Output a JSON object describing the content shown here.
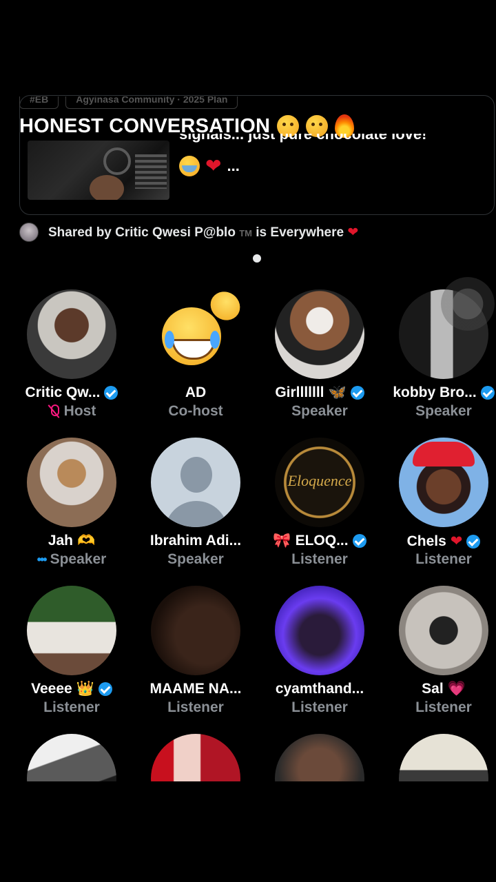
{
  "space": {
    "title": "HONEST CONVERSATION",
    "title_emojis": [
      "shushing-face-emoji",
      "steam-face-emoji",
      "fire-emoji"
    ],
    "tags": [
      "#EB",
      "Agyinasa Community · 2025 Plan"
    ],
    "preview_text_top": "signals... just pure chocolate love!",
    "preview_text_bottom": "..."
  },
  "shared_by": {
    "prefix": "Shared by Critic Qwesi P@blo",
    "tm": "TM",
    "suffix": "is Everywhere"
  },
  "colors": {
    "background": "#000000",
    "verified": "#1d9bf0",
    "host_mic": "#f91880",
    "role_text": "#8b9096"
  },
  "participants": [
    {
      "name": "Critic Qw...",
      "role": "Host",
      "verified": true,
      "icon": "mic-off-icon"
    },
    {
      "name": "AD",
      "role": "Co-host",
      "verified": false
    },
    {
      "name": "Girlllllll",
      "role": "Speaker",
      "verified": true,
      "name_emoji": "butterfly-emoji"
    },
    {
      "name": "kobby Bro...",
      "role": "Speaker",
      "verified": true
    },
    {
      "name": "Jah",
      "role": "Speaker",
      "verified": false,
      "name_emoji": "heart-hands-emoji",
      "icon": "talking-dots-icon"
    },
    {
      "name": "Ibrahim Adi...",
      "role": "Speaker",
      "verified": false
    },
    {
      "name": "ELOQ...",
      "role": "Listener",
      "verified": true,
      "name_emoji": "ribbon-emoji",
      "avatar_text": "Eloquence"
    },
    {
      "name": "Chels",
      "role": "Listener",
      "verified": true,
      "name_emoji": "red-heart-emoji"
    },
    {
      "name": "Veeee",
      "role": "Listener",
      "verified": true,
      "name_emoji": "crown-emoji"
    },
    {
      "name": "MAAME NA...",
      "role": "Listener",
      "verified": false
    },
    {
      "name": "cyamthand...",
      "role": "Listener",
      "verified": false
    },
    {
      "name": "Sal",
      "role": "Listener",
      "verified": false,
      "name_emoji": "pink-heart-emoji"
    }
  ]
}
